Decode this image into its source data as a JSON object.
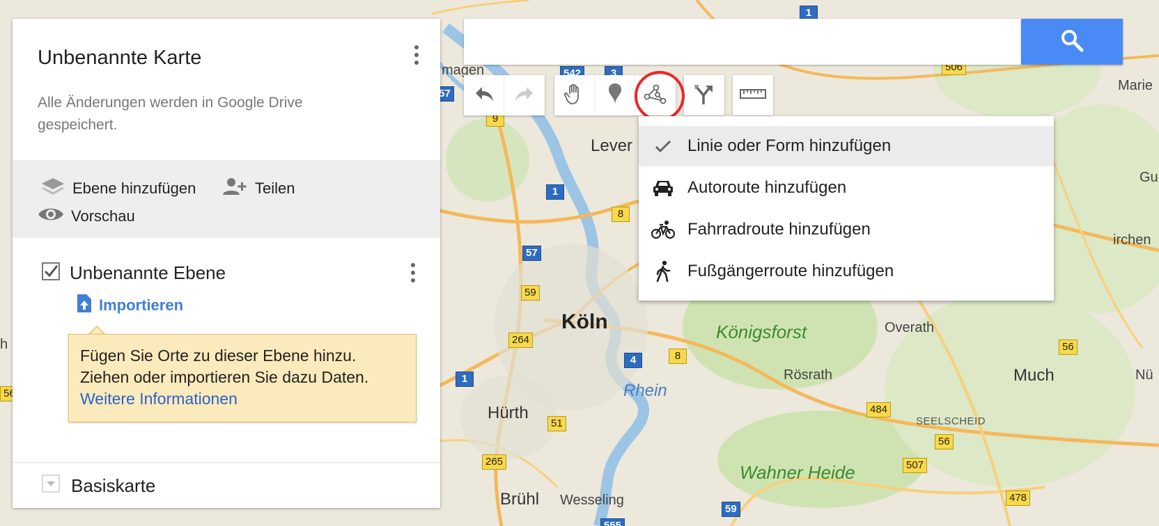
{
  "panel": {
    "map_title": "Unbenannte Karte",
    "save_note": "Alle Änderungen werden in Google Drive gespeichert.",
    "add_layer": "Ebene hinzufügen",
    "share": "Teilen",
    "preview": "Vorschau",
    "layer_title": "Unbenannte Ebene",
    "import": "Importieren",
    "tooltip_text": "Fügen Sie Orte zu dieser Ebene hinzu. Ziehen oder importieren Sie dazu Daten.",
    "tooltip_link": "Weitere Informationen",
    "basemap": "Basiskarte"
  },
  "search": {
    "value": "",
    "placeholder": ""
  },
  "toolbar": {
    "items": [
      "undo-icon",
      "redo-icon",
      "hand-icon",
      "marker-icon",
      "draw-line-icon",
      "directions-icon",
      "ruler-icon"
    ],
    "active": "draw-line-icon"
  },
  "dropdown": {
    "items": [
      {
        "label": "Linie oder Form hinzufügen",
        "icon": "checkmark-icon",
        "selected": true
      },
      {
        "label": "Autoroute hinzufügen",
        "icon": "car-icon",
        "selected": false
      },
      {
        "label": "Fahrradroute hinzufügen",
        "icon": "bicycle-icon",
        "selected": false
      },
      {
        "label": "Fußgängerroute hinzufügen",
        "icon": "walking-icon",
        "selected": false
      }
    ]
  },
  "map": {
    "places": {
      "koeln": "Köln",
      "lever": "Lever",
      "koenigsforst": "Königsforst",
      "overath": "Overath",
      "roesrath": "Rösrath",
      "much": "Much",
      "seelscheid": "SEELSCHEID",
      "huerth": "Hürth",
      "wahner_heide": "Wahner Heide",
      "bruehl": "Brühl",
      "wesseling": "Wesseling",
      "rhein": "Rhein",
      "magen": "magen",
      "marie": "Marie",
      "gu": "Gu",
      "irchen": "irchen",
      "nu": "Nü",
      "h": "h"
    },
    "shields": {
      "s1": "542",
      "s2": "3",
      "s3": "57",
      "s4": "9",
      "s5": "506",
      "s6": "1",
      "s7": "8",
      "s8": "57",
      "s9": "59",
      "s10": "264",
      "s11": "8",
      "s12": "4",
      "s13": "1",
      "s14": "56",
      "s15": "484",
      "s16": "51",
      "s17": "56",
      "s18": "265",
      "s19": "507",
      "s20": "478",
      "s21": "59",
      "s22": "1",
      "s23": "56",
      "s24": "555"
    }
  },
  "colors": {
    "accent_blue": "#4a8af4",
    "highlight_red": "#e8282b",
    "tooltip_bg": "#fbeabb",
    "link_blue": "#3f7fd6"
  }
}
